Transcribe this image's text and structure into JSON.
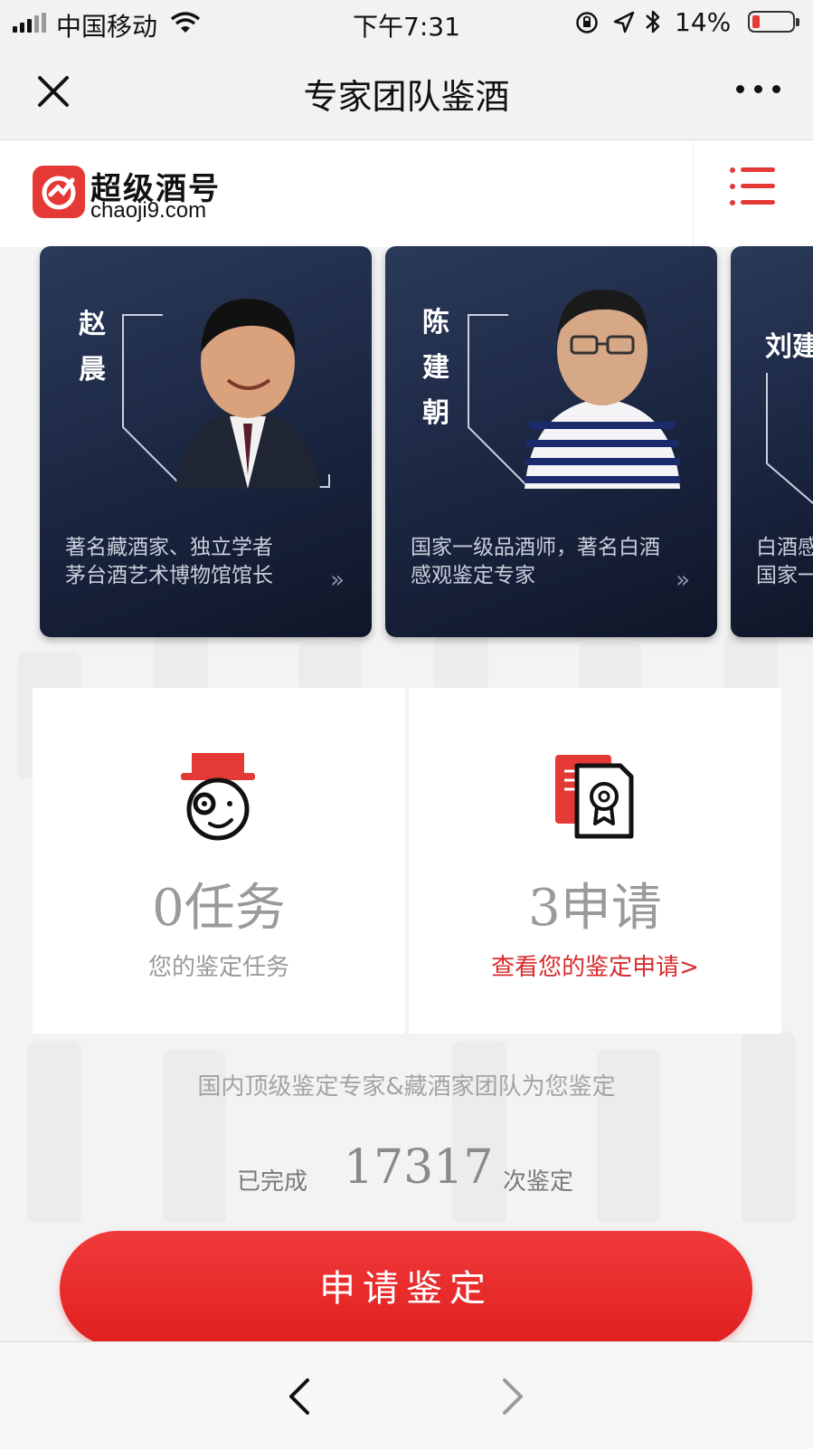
{
  "status_bar": {
    "carrier": "中国移动",
    "time": "下午7:31",
    "battery_percent": "14%",
    "battery_level": 0.14,
    "icons": [
      "signal-icon",
      "wifi-icon",
      "orientation-lock-icon",
      "location-icon",
      "bluetooth-icon",
      "battery-icon"
    ]
  },
  "nav_bar": {
    "title": "专家团队鉴酒",
    "close_icon": "close-icon",
    "more_icon": "more-icon"
  },
  "site_header": {
    "logo_text": "超级酒号",
    "logo_domain": "chaoji9.com",
    "menu_icon": "menu-icon",
    "accent_color": "#e53935"
  },
  "experts": [
    {
      "name_chars": [
        "赵",
        "晨"
      ],
      "desc_lines": [
        "著名藏酒家、独立学者",
        "茅台酒艺术博物馆馆长"
      ],
      "more": "»"
    },
    {
      "name_chars": [
        "陈",
        "建",
        "朝"
      ],
      "desc_lines": [
        "国家一级品酒师，著名白酒",
        "感观鉴定专家"
      ],
      "more": "»"
    },
    {
      "name_chars": [
        "刘",
        "建"
      ],
      "desc_lines": [
        "白酒感",
        "国家一"
      ],
      "more": "»"
    }
  ],
  "stats": {
    "tasks": {
      "value": "0任务",
      "label": "您的鉴定任务",
      "icon": "inspector-icon"
    },
    "applications": {
      "value": "3申请",
      "label": "查看您的鉴定申请>",
      "icon": "certificate-icon"
    }
  },
  "tagline": "国内顶级鉴定专家&藏酒家团队为您鉴定",
  "completed": {
    "prefix": "已完成",
    "count": "17317",
    "suffix": "次鉴定"
  },
  "apply_button": "申请鉴定",
  "browser_toolbar": {
    "back_icon": "back-icon",
    "forward_icon": "forward-icon"
  }
}
